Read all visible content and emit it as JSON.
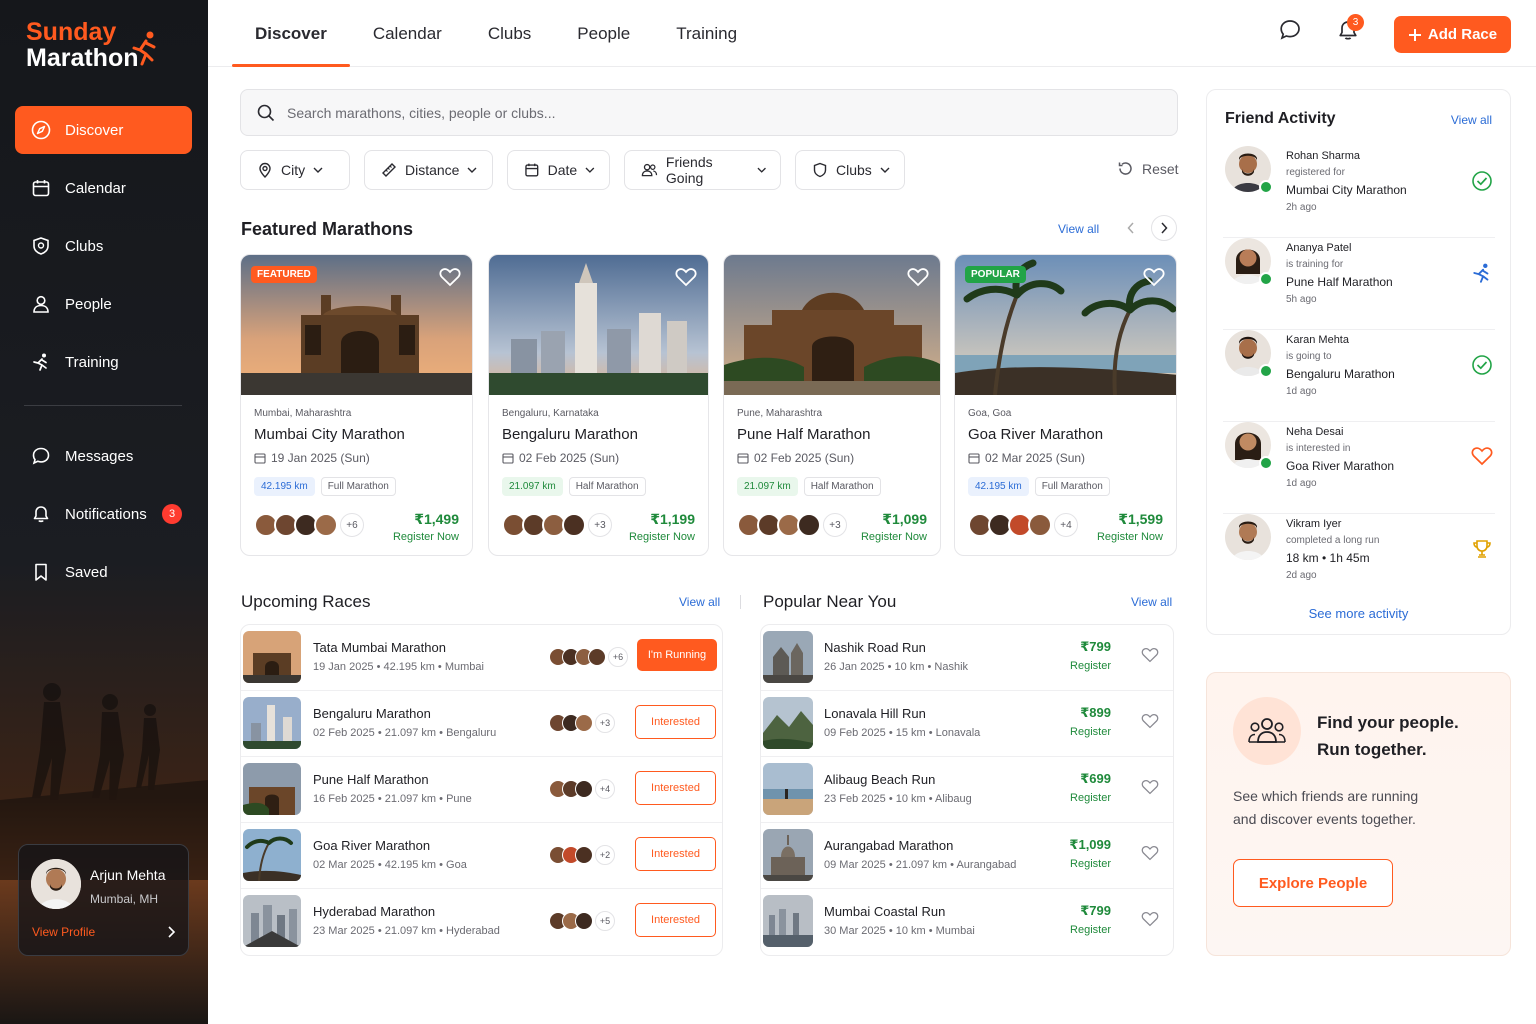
{
  "app": {
    "logo_line1": "Sunday",
    "logo_line2": "Marathon",
    "accent": "#ff5a1f"
  },
  "sidebar": {
    "items": [
      {
        "label": "Discover",
        "icon": "compass-icon",
        "active": true
      },
      {
        "label": "Calendar",
        "icon": "calendar-icon"
      },
      {
        "label": "Clubs",
        "icon": "shield-icon"
      },
      {
        "label": "People",
        "icon": "user-icon"
      },
      {
        "label": "Training",
        "icon": "runner-icon"
      }
    ],
    "items2": [
      {
        "label": "Messages",
        "icon": "message-icon"
      },
      {
        "label": "Notifications",
        "icon": "bell-icon",
        "badge": "3"
      },
      {
        "label": "Saved",
        "icon": "bookmark-icon"
      }
    ],
    "profile": {
      "name": "Arjun Mehta",
      "location": "Mumbai, MH",
      "link": "View Profile"
    }
  },
  "topnav": {
    "tabs": [
      "Discover",
      "Calendar",
      "Clubs",
      "People",
      "Training"
    ],
    "notif_count": "3",
    "add_race": "Add Race"
  },
  "search": {
    "placeholder": "Search marathons, cities, people or clubs..."
  },
  "filters": [
    "City",
    "Distance",
    "Date",
    "Friends Going",
    "Clubs"
  ],
  "reset": "Reset",
  "featured": {
    "title": "Featured Marathons",
    "view_all": "View all",
    "cards": [
      {
        "tag": "FEATURED",
        "loc": "Mumbai, Maharashtra",
        "name": "Mumbai City Marathon",
        "date": "19 Jan 2025 (Sun)",
        "dist": "42.195 km",
        "type": "Full Marathon",
        "more": "+6",
        "price": "₹1,499",
        "cta": "Register Now"
      },
      {
        "tag": "",
        "loc": "Bengaluru, Karnataka",
        "name": "Bengaluru Marathon",
        "date": "02 Feb 2025 (Sun)",
        "dist": "21.097 km",
        "type": "Half Marathon",
        "more": "+3",
        "price": "₹1,199",
        "cta": "Register Now"
      },
      {
        "tag": "",
        "loc": "Pune, Maharashtra",
        "name": "Pune Half Marathon",
        "date": "02 Feb 2025 (Sun)",
        "dist": "21.097 km",
        "type": "Half Marathon",
        "more": "+3",
        "price": "₹1,099",
        "cta": "Register Now"
      },
      {
        "tag": "POPULAR",
        "loc": "Goa, Goa",
        "name": "Goa River Marathon",
        "date": "02 Mar 2025 (Sun)",
        "dist": "42.195 km",
        "type": "Full Marathon",
        "more": "+4",
        "price": "₹1,599",
        "cta": "Register Now"
      }
    ]
  },
  "upcoming": {
    "title": "Upcoming Races",
    "view_all": "View all",
    "rows": [
      {
        "name": "Tata Mumbai Marathon",
        "meta": "19 Jan 2025  •  42.195 km  •  Mumbai",
        "more": "+6",
        "action": "I'm Running"
      },
      {
        "name": "Bengaluru Marathon",
        "meta": "02 Feb 2025  •  21.097 km  •  Bengaluru",
        "more": "+3",
        "action": "Interested"
      },
      {
        "name": "Pune Half Marathon",
        "meta": "16 Feb 2025  •  21.097 km  •  Pune",
        "more": "+4",
        "action": "Interested"
      },
      {
        "name": "Goa River Marathon",
        "meta": "02 Mar 2025  •  42.195 km  •  Goa",
        "more": "+2",
        "action": "Interested"
      },
      {
        "name": "Hyderabad Marathon",
        "meta": "23 Mar 2025  •  21.097 km  •  Hyderabad",
        "more": "+5",
        "action": "Interested"
      }
    ]
  },
  "popular": {
    "title": "Popular Near You",
    "view_all": "View all",
    "rows": [
      {
        "name": "Nashik Road Run",
        "meta": "26 Jan 2025  •  10 km  •  Nashik",
        "price": "₹799",
        "cta": "Register"
      },
      {
        "name": "Lonavala Hill Run",
        "meta": "09 Feb 2025  •  15 km  •  Lonavala",
        "price": "₹899",
        "cta": "Register"
      },
      {
        "name": "Alibaug Beach Run",
        "meta": "23 Feb 2025  •  10 km  •  Alibaug",
        "price": "₹699",
        "cta": "Register"
      },
      {
        "name": "Aurangabad Marathon",
        "meta": "09 Mar 2025  •  21.097 km  •  Aurangabad",
        "price": "₹1,099",
        "cta": "Register"
      },
      {
        "name": "Mumbai Coastal Run",
        "meta": "30 Mar 2025  •  10 km  •  Mumbai",
        "price": "₹799",
        "cta": "Register"
      }
    ]
  },
  "activity": {
    "title": "Friend Activity",
    "view_all": "View all",
    "items": [
      {
        "name": "Rohan Sharma",
        "verb": "registered for",
        "event": "Mumbai City Marathon",
        "time": "2h ago",
        "icon": "check-circle-icon"
      },
      {
        "name": "Ananya Patel",
        "verb": "is training for",
        "event": "Pune Half Marathon",
        "time": "5h ago",
        "icon": "runner-icon"
      },
      {
        "name": "Karan Mehta",
        "verb": "is going to",
        "event": "Bengaluru Marathon",
        "time": "1d ago",
        "icon": "check-circle-icon"
      },
      {
        "name": "Neha Desai",
        "verb": "is interested in",
        "event": "Goa River Marathon",
        "time": "1d ago",
        "icon": "heart-icon"
      },
      {
        "name": "Vikram Iyer",
        "verb": "completed a long run",
        "event": "18 km  •  1h 45m",
        "time": "2d ago",
        "icon": "trophy-icon"
      }
    ],
    "see_more": "See more activity"
  },
  "promo": {
    "line1": "Find your people.",
    "line2": "Run together.",
    "text1": "See which friends are running",
    "text2": "and discover events together.",
    "button": "Explore People"
  }
}
